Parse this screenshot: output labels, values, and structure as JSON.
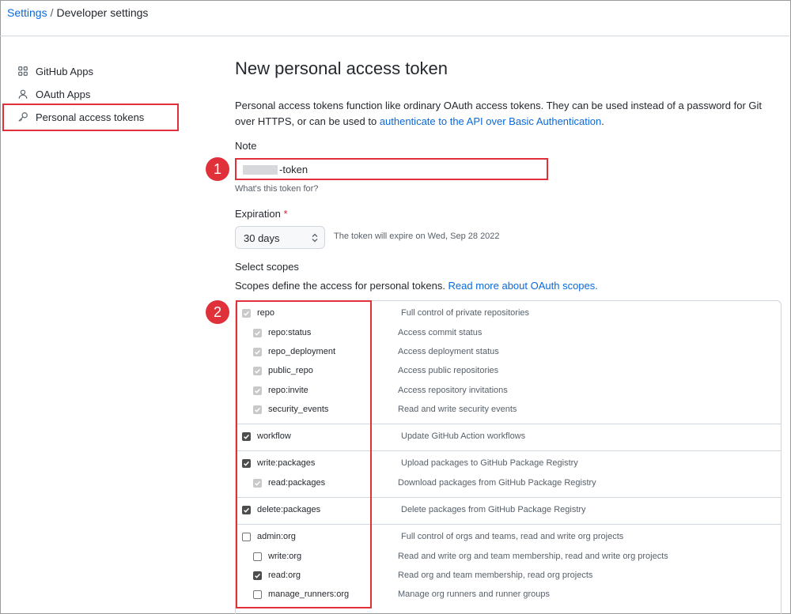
{
  "breadcrumb": {
    "root": "Settings",
    "separator": "/",
    "current": "Developer settings"
  },
  "sidebar": {
    "items": [
      {
        "label": "GitHub Apps",
        "icon": "apps-grid-icon"
      },
      {
        "label": "OAuth Apps",
        "icon": "person-icon"
      },
      {
        "label": "Personal access tokens",
        "icon": "key-icon",
        "highlighted": true
      }
    ]
  },
  "page": {
    "title": "New personal access token",
    "description": "Personal access tokens function like ordinary OAuth access tokens. They can be used instead of a password for Git over HTTPS, or can be used to ",
    "description_link": "authenticate to the API over Basic Authentication",
    "description_end": "."
  },
  "note": {
    "label": "Note",
    "value_suffix": "-token",
    "hint": "What's this token for?"
  },
  "expiration": {
    "label": "Expiration",
    "required_mark": "*",
    "selected": "30 days",
    "info": "The token will expire on Wed, Sep 28 2022"
  },
  "scopes_section": {
    "label": "Select scopes",
    "description": "Scopes define the access for personal tokens. ",
    "link": "Read more about OAuth scopes."
  },
  "markers": {
    "step1": "1",
    "step2": "2"
  },
  "scopes": [
    {
      "name": "repo",
      "desc": "Full control of private repositories",
      "state": "disabled-checked",
      "child": false
    },
    {
      "name": "repo:status",
      "desc": "Access commit status",
      "state": "disabled-checked",
      "child": true
    },
    {
      "name": "repo_deployment",
      "desc": "Access deployment status",
      "state": "disabled-checked",
      "child": true
    },
    {
      "name": "public_repo",
      "desc": "Access public repositories",
      "state": "disabled-checked",
      "child": true
    },
    {
      "name": "repo:invite",
      "desc": "Access repository invitations",
      "state": "disabled-checked",
      "child": true
    },
    {
      "name": "security_events",
      "desc": "Read and write security events",
      "state": "disabled-checked",
      "child": true
    },
    {
      "name": "workflow",
      "desc": "Update GitHub Action workflows",
      "state": "checked",
      "child": false
    },
    {
      "name": "write:packages",
      "desc": "Upload packages to GitHub Package Registry",
      "state": "checked",
      "child": false
    },
    {
      "name": "read:packages",
      "desc": "Download packages from GitHub Package Registry",
      "state": "disabled-checked",
      "child": true
    },
    {
      "name": "delete:packages",
      "desc": "Delete packages from GitHub Package Registry",
      "state": "checked",
      "child": false
    },
    {
      "name": "admin:org",
      "desc": "Full control of orgs and teams, read and write org projects",
      "state": "unchecked",
      "child": false
    },
    {
      "name": "write:org",
      "desc": "Read and write org and team membership, read and write org projects",
      "state": "unchecked",
      "child": true
    },
    {
      "name": "read:org",
      "desc": "Read org and team membership, read org projects",
      "state": "checked",
      "child": true
    },
    {
      "name": "manage_runners:org",
      "desc": "Manage org runners and runner groups",
      "state": "unchecked",
      "child": true
    }
  ],
  "colors": {
    "link": "#0969da",
    "highlight": "#e0313b",
    "required": "#cf222e"
  }
}
